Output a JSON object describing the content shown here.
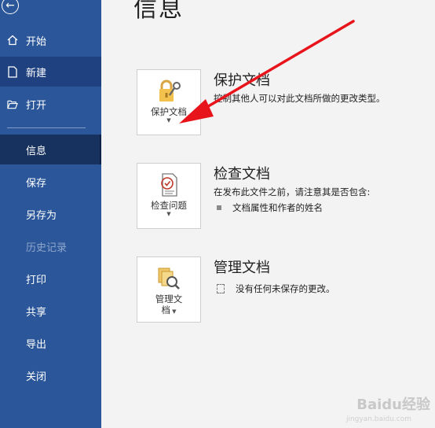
{
  "sidebar": {
    "items": [
      {
        "label": "开始"
      },
      {
        "label": "新建"
      },
      {
        "label": "打开"
      },
      {
        "label": "信息"
      },
      {
        "label": "保存"
      },
      {
        "label": "另存为"
      },
      {
        "label": "历史记录"
      },
      {
        "label": "打印"
      },
      {
        "label": "共享"
      },
      {
        "label": "导出"
      },
      {
        "label": "关闭"
      }
    ]
  },
  "page": {
    "title": "信息"
  },
  "sections": {
    "protect": {
      "button_label": "保护文档",
      "title": "保护文档",
      "description": "控制其他人可以对此文档所做的更改类型。"
    },
    "inspect": {
      "button_label": "检查问题",
      "title": "检查文档",
      "description": "在发布此文件之前，请注意其是否包含:",
      "bullet": "文档属性和作者的姓名"
    },
    "manage": {
      "button_label_line1": "管理文",
      "button_label_line2": "档",
      "title": "管理文档",
      "detail": "没有任何未保存的更改。"
    }
  },
  "watermark": {
    "text": "Baidu经验",
    "sub": "jingyan.baidu.com"
  },
  "colors": {
    "sidebar": "#2b579a",
    "selected": "#17325f",
    "arrow": "#e8141c"
  }
}
